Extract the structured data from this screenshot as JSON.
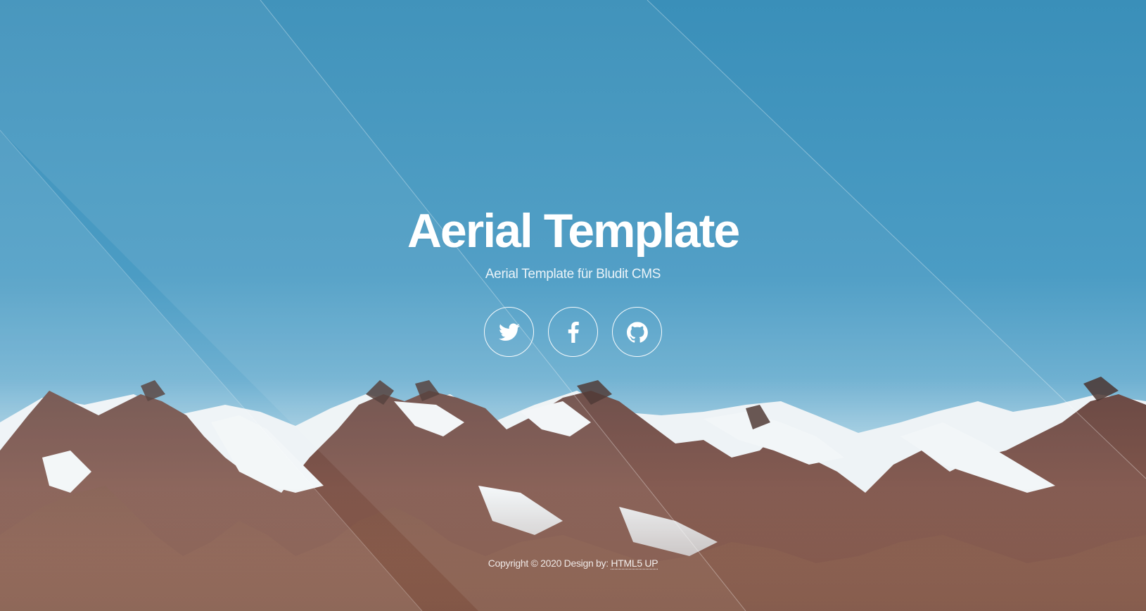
{
  "site": {
    "title": "Aerial Template",
    "subtitle": "Aerial Template für Bludit CMS"
  },
  "social": [
    {
      "name": "Twitter",
      "icon": "twitter-icon"
    },
    {
      "name": "Facebook",
      "icon": "facebook-icon"
    },
    {
      "name": "GitHub",
      "icon": "github-icon"
    }
  ],
  "footer": {
    "copyright_text": "Copyright © 2020 Design by:",
    "credit_link": "HTML5 UP"
  },
  "colors": {
    "sky": "#3f93bb",
    "sky_light": "#8ec3dc",
    "text": "#ffffff",
    "rock": "#8a5a4a",
    "snow": "#f1f5f8"
  }
}
